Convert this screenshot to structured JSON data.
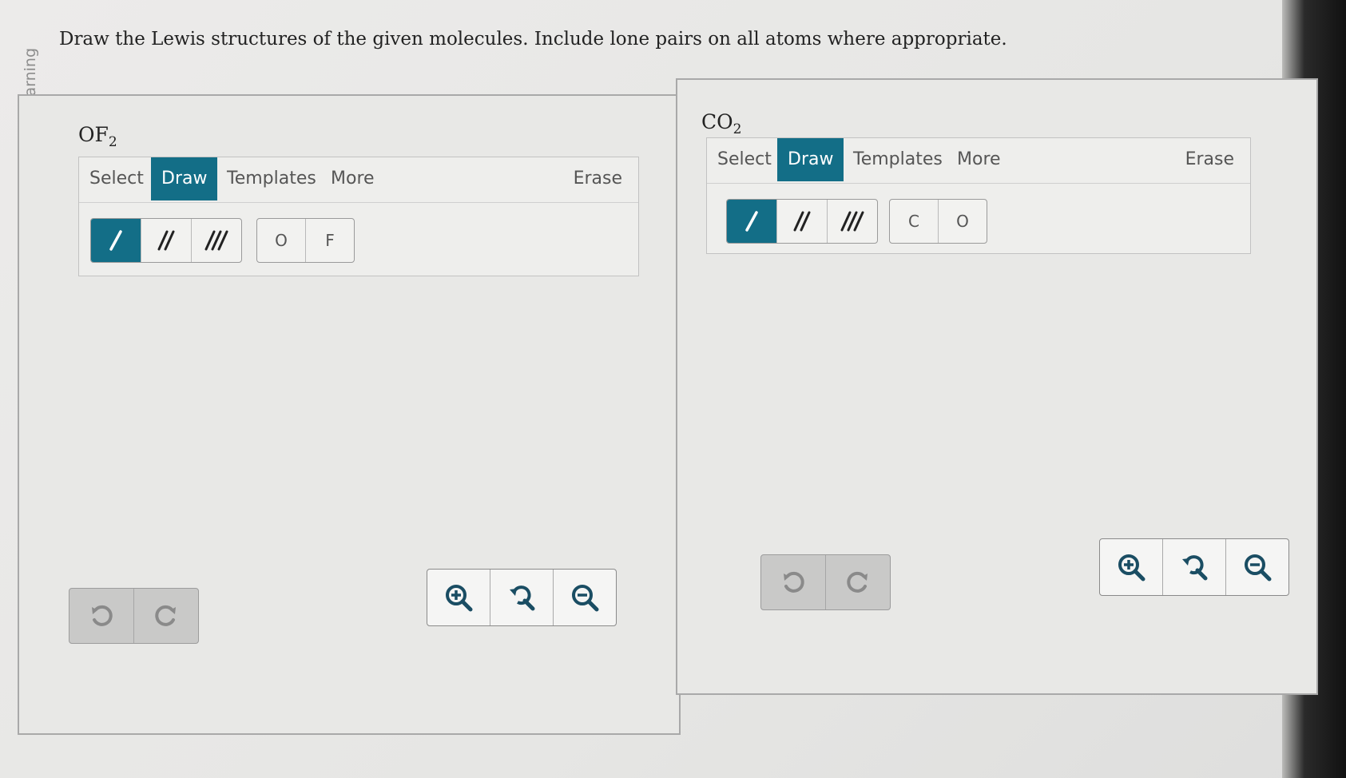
{
  "watermark": "© Macmillan Learning",
  "instruction": "Draw the Lewis structures of the given molecules. Include lone pairs on all atoms where appropriate.",
  "colors": {
    "accent": "#136e87",
    "panel_bg": "#e8e8e6"
  },
  "panels": [
    {
      "molecule_base": "OF",
      "molecule_sub": "2",
      "tabs": [
        "Select",
        "Draw",
        "Templates",
        "More"
      ],
      "active_tab": "Draw",
      "erase_label": "Erase",
      "bond_tools": [
        "single-bond",
        "double-bond",
        "triple-bond"
      ],
      "atoms": [
        "O",
        "F"
      ],
      "history_icons": [
        "undo-icon",
        "redo-icon"
      ],
      "zoom_icons": [
        "zoom-in-icon",
        "zoom-reset-icon",
        "zoom-out-icon"
      ]
    },
    {
      "molecule_base": "CO",
      "molecule_sub": "2",
      "tabs": [
        "Select",
        "Draw",
        "Templates",
        "More"
      ],
      "active_tab": "Draw",
      "erase_label": "Erase",
      "bond_tools": [
        "single-bond",
        "double-bond",
        "triple-bond"
      ],
      "atoms": [
        "C",
        "O"
      ],
      "history_icons": [
        "undo-icon",
        "redo-icon"
      ],
      "zoom_icons": [
        "zoom-in-icon",
        "zoom-reset-icon",
        "zoom-out-icon"
      ]
    }
  ]
}
